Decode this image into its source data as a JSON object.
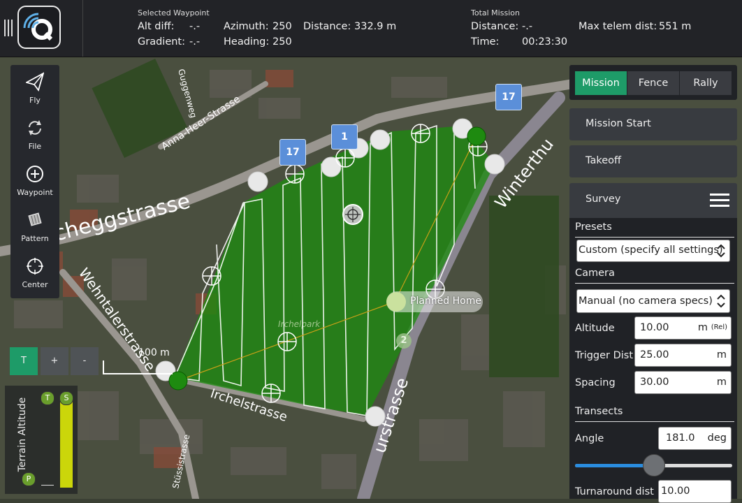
{
  "topbar": {
    "selected_waypoint": {
      "header": "Selected Waypoint",
      "alt_diff_label": "Alt diff:",
      "alt_diff_value": "-.-",
      "gradient_label": "Gradient:",
      "gradient_value": "-.-",
      "azimuth_label": "Azimuth:",
      "azimuth_value": "250",
      "heading_label": "Heading:",
      "heading_value": "250",
      "distance_label": "Distance:",
      "distance_value": "332.9 m"
    },
    "total_mission": {
      "header": "Total Mission",
      "distance_label": "Distance:",
      "distance_value": "-.-",
      "time_label": "Time:",
      "time_value": "00:23:30",
      "max_telem_label": "Max telem dist:",
      "max_telem_value": "551 m"
    }
  },
  "tools": [
    {
      "label": "Fly",
      "icon": "paper-plane-icon"
    },
    {
      "label": "File",
      "icon": "sync-icon"
    },
    {
      "label": "Waypoint",
      "icon": "plus-circle-icon"
    },
    {
      "label": "Pattern",
      "icon": "pattern-icon"
    },
    {
      "label": "Center",
      "icon": "crosshair-icon"
    }
  ],
  "zoom": {
    "terrain_label": "T",
    "zoom_in_label": "+",
    "zoom_out_label": "-"
  },
  "scale": {
    "label": "100 m"
  },
  "terrain": {
    "title": "Terrain Altitude",
    "t_badge": "T",
    "s_badge": "S",
    "p_badge": "P"
  },
  "map": {
    "planned_home_label": "Planned Home",
    "waypoint_badges": [
      "17",
      "1",
      "17",
      "2"
    ],
    "street_labels": [
      "Anna-Heer-Strasse",
      "cheggstrasse",
      "Wehntalerstrasse",
      "Irchelstrasse",
      "urstrasse",
      "Winterthu",
      "Stüssistrasse",
      "Irchelpark",
      "Guggenweg"
    ]
  },
  "panel": {
    "tabs": [
      {
        "label": "Mission",
        "active": true
      },
      {
        "label": "Fence",
        "active": false
      },
      {
        "label": "Rally",
        "active": false
      }
    ],
    "mission_start": "Mission Start",
    "takeoff": "Takeoff",
    "survey": {
      "title": "Survey",
      "presets_label": "Presets",
      "presets_value": "Custom (specify all settings)",
      "camera_label": "Camera",
      "camera_value": "Manual (no camera specs)",
      "altitude_label": "Altitude",
      "altitude_value": "10.00",
      "altitude_unit": "m",
      "altitude_ref": "(Rel)",
      "trigger_label": "Trigger Dist",
      "trigger_value": "25.00",
      "trigger_unit": "m",
      "spacing_label": "Spacing",
      "spacing_value": "30.00",
      "spacing_unit": "m",
      "transects_label": "Transects",
      "angle_label": "Angle",
      "angle_value": "181.0",
      "angle_unit": "deg",
      "angle_slider_fraction": 0.5,
      "turnaround_label": "Turnaround dist",
      "turnaround_value": "10.00"
    }
  },
  "colors": {
    "accent": "#1e9b68",
    "survey_fill": "#1e8a10",
    "slider": "#2a8de0",
    "waypoint_badge": "#5b8fd9"
  }
}
